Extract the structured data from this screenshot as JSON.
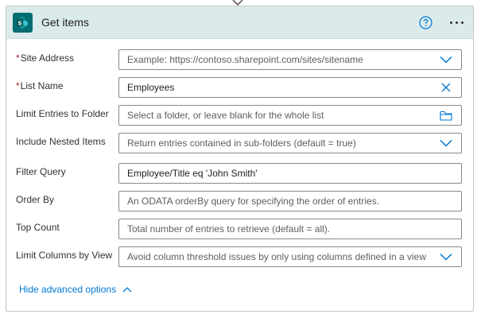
{
  "action": {
    "title": "Get items",
    "logo_icon": "sharepoint-logo",
    "header_color": "#dbeaea",
    "accent_color": "#0078d4",
    "help_icon": "question-circle-icon",
    "more_icon": "ellipsis-icon"
  },
  "fields": {
    "site_address": {
      "label": "Site Address",
      "required_mark": "*",
      "placeholder": "Example: https://contoso.sharepoint.com/sites/sitename",
      "icon": "chevron-down-icon"
    },
    "list_name": {
      "label": "List Name",
      "required_mark": "*",
      "value": "Employees",
      "icon": "clear-icon"
    },
    "limit_folder": {
      "label": "Limit Entries to Folder",
      "placeholder": "Select a folder, or leave blank for the whole list",
      "icon": "folder-icon"
    },
    "nested_items": {
      "label": "Include Nested Items",
      "placeholder": "Return entries contained in sub-folders (default = true)",
      "icon": "chevron-down-icon"
    },
    "filter_query": {
      "label": "Filter Query",
      "value": "Employee/Title eq 'John Smith'"
    },
    "order_by": {
      "label": "Order By",
      "placeholder": "An ODATA orderBy query for specifying the order of entries."
    },
    "top_count": {
      "label": "Top Count",
      "placeholder": "Total number of entries to retrieve (default = all)."
    },
    "limit_columns": {
      "label": "Limit Columns by View",
      "placeholder": "Avoid column threshold issues by only using columns defined in a view",
      "icon": "chevron-down-icon"
    }
  },
  "advanced": {
    "label": "Hide advanced options",
    "icon": "chevron-up-icon"
  }
}
